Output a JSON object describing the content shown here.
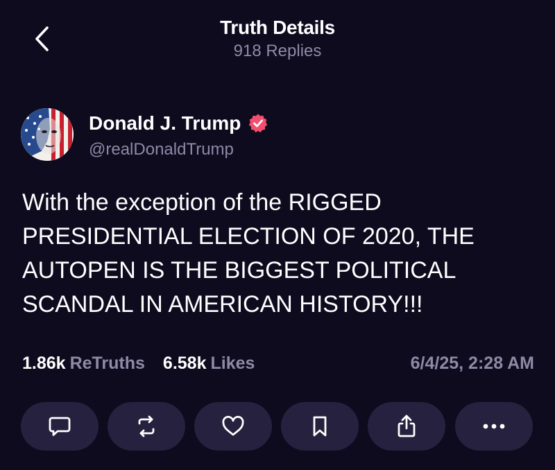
{
  "header": {
    "title": "Truth Details",
    "subtitle": "918 Replies",
    "back_icon": "chevron-left-icon"
  },
  "post": {
    "author": {
      "name": "Donald J. Trump",
      "handle": "@realDonaldTrump",
      "verified": true,
      "avatar": "flag-portrait-avatar"
    },
    "body": "With the exception of the RIGGED\nPRESIDENTIAL ELECTION OF 2020, THE\nAUTOPEN IS THE BIGGEST POLITICAL\nSCANDAL IN AMERICAN HISTORY!!!",
    "stats": {
      "retruths_count": "1.86k",
      "retruths_label": "ReTruths",
      "likes_count": "6.58k",
      "likes_label": "Likes"
    },
    "timestamp": "6/4/25, 2:28 AM"
  },
  "actions": [
    {
      "name": "reply",
      "icon": "reply-bubble-icon"
    },
    {
      "name": "retruth",
      "icon": "retruth-icon"
    },
    {
      "name": "like",
      "icon": "heart-icon"
    },
    {
      "name": "bookmark",
      "icon": "bookmark-icon"
    },
    {
      "name": "share",
      "icon": "share-icon"
    },
    {
      "name": "more",
      "icon": "more-dots-icon"
    }
  ],
  "colors": {
    "background": "#0e0b1f",
    "muted_text": "#8e8aa6",
    "button_bg": "#26213e",
    "verified_badge": "#f24f6f"
  }
}
